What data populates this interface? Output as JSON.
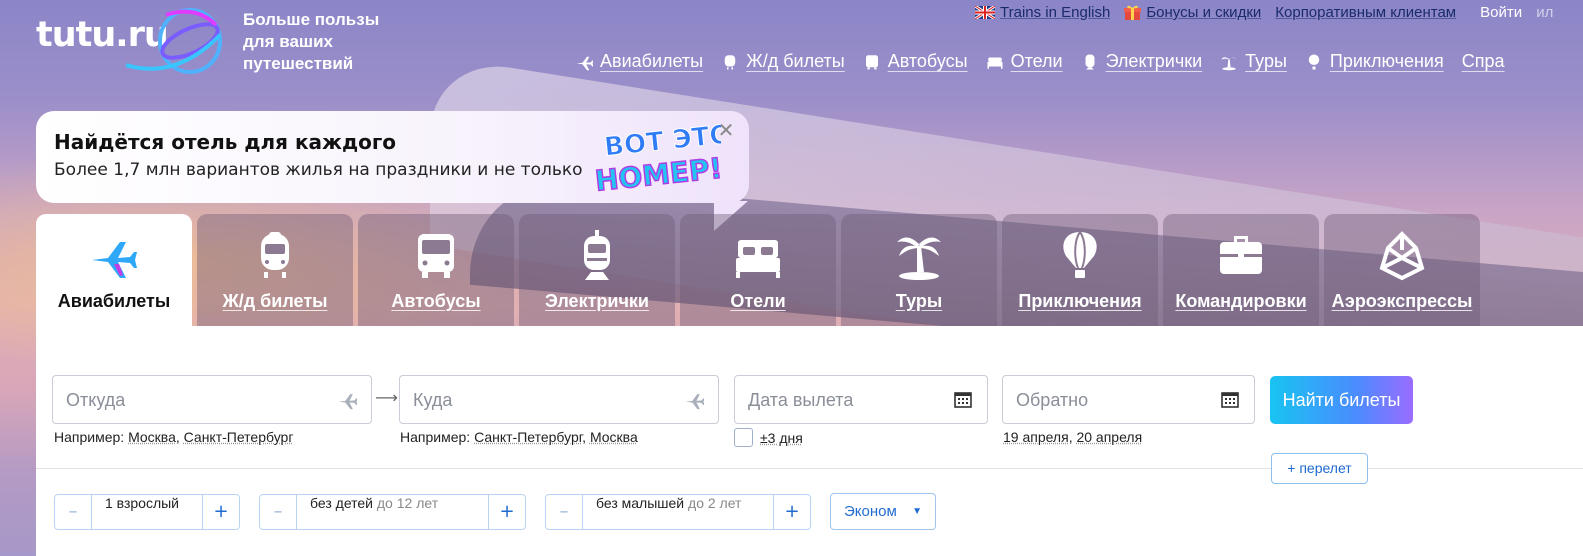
{
  "brand": {
    "logo_text": "tutu.ru",
    "slogan_1": "Больше пользы",
    "slogan_2": "для ваших",
    "slogan_3": "путешествий"
  },
  "top_links": [
    {
      "label": "Trains in English",
      "icon": "uk-flag-icon"
    },
    {
      "label": "Бонусы и скидки",
      "icon": "gift-icon"
    },
    {
      "label": "Корпоративным клиентам"
    }
  ],
  "login": {
    "label": "Войти",
    "dim": "ил"
  },
  "nav": [
    {
      "label": "Авиабилеты",
      "icon": "plane-icon"
    },
    {
      "label": "Ж/д билеты",
      "icon": "train-icon"
    },
    {
      "label": "Автобусы",
      "icon": "bus-icon"
    },
    {
      "label": "Отели",
      "icon": "bed-icon"
    },
    {
      "label": "Электрички",
      "icon": "suburban-train-icon"
    },
    {
      "label": "Туры",
      "icon": "palm-icon"
    },
    {
      "label": "Приключения",
      "icon": "balloon-icon"
    },
    {
      "label": "Спра"
    }
  ],
  "promo": {
    "title": "Найдётся отель для каждого",
    "subtitle": "Более 1,7 млн вариантов жилья на праздники и не только",
    "logo_1": "ВОТ ЭТО",
    "logo_2": "НОМЕР!"
  },
  "tabs": [
    {
      "label": "Авиабилеты",
      "icon": "plane-icon",
      "active": true
    },
    {
      "label": "Ж/д билеты",
      "icon": "train-icon"
    },
    {
      "label": "Автобусы",
      "icon": "bus-icon"
    },
    {
      "label": "Электрички",
      "icon": "suburban-train-icon"
    },
    {
      "label": "Отели",
      "icon": "bed-icon"
    },
    {
      "label": "Туры",
      "icon": "palm-icon"
    },
    {
      "label": "Приключения",
      "icon": "balloon-icon"
    },
    {
      "label": "Командировки",
      "icon": "briefcase-icon"
    },
    {
      "label": "Аэроэкспрессы",
      "icon": "aeroexpress-icon"
    }
  ],
  "form": {
    "from": {
      "placeholder": "Откуда",
      "hint_prefix": "Например:",
      "hint_1": "Москва",
      "hint_2": "Санкт-Петербург"
    },
    "to": {
      "placeholder": "Куда",
      "hint_prefix": "Например:",
      "hint_1": "Санкт-Петербург",
      "hint_2": "Москва"
    },
    "depart": {
      "placeholder": "Дата вылета",
      "flex": "±3 дня"
    },
    "return": {
      "placeholder": "Обратно",
      "hint_1": "19 апреля",
      "hint_2": "20 апреля"
    },
    "search_button": "Найти билеты",
    "add_flight": "+ перелет",
    "adults": {
      "value": "1 взрослый"
    },
    "children": {
      "value": "без детей",
      "dim": "до 12 лет"
    },
    "infants": {
      "value": "без малышей",
      "dim": "до 2 лет"
    },
    "cabin_class": "Эконом",
    "minus": "–",
    "plus": "+"
  },
  "colors": {
    "accent": "#1f6bd1",
    "search_gradient_start": "#18c4f1",
    "search_gradient_end": "#9a6cff"
  }
}
